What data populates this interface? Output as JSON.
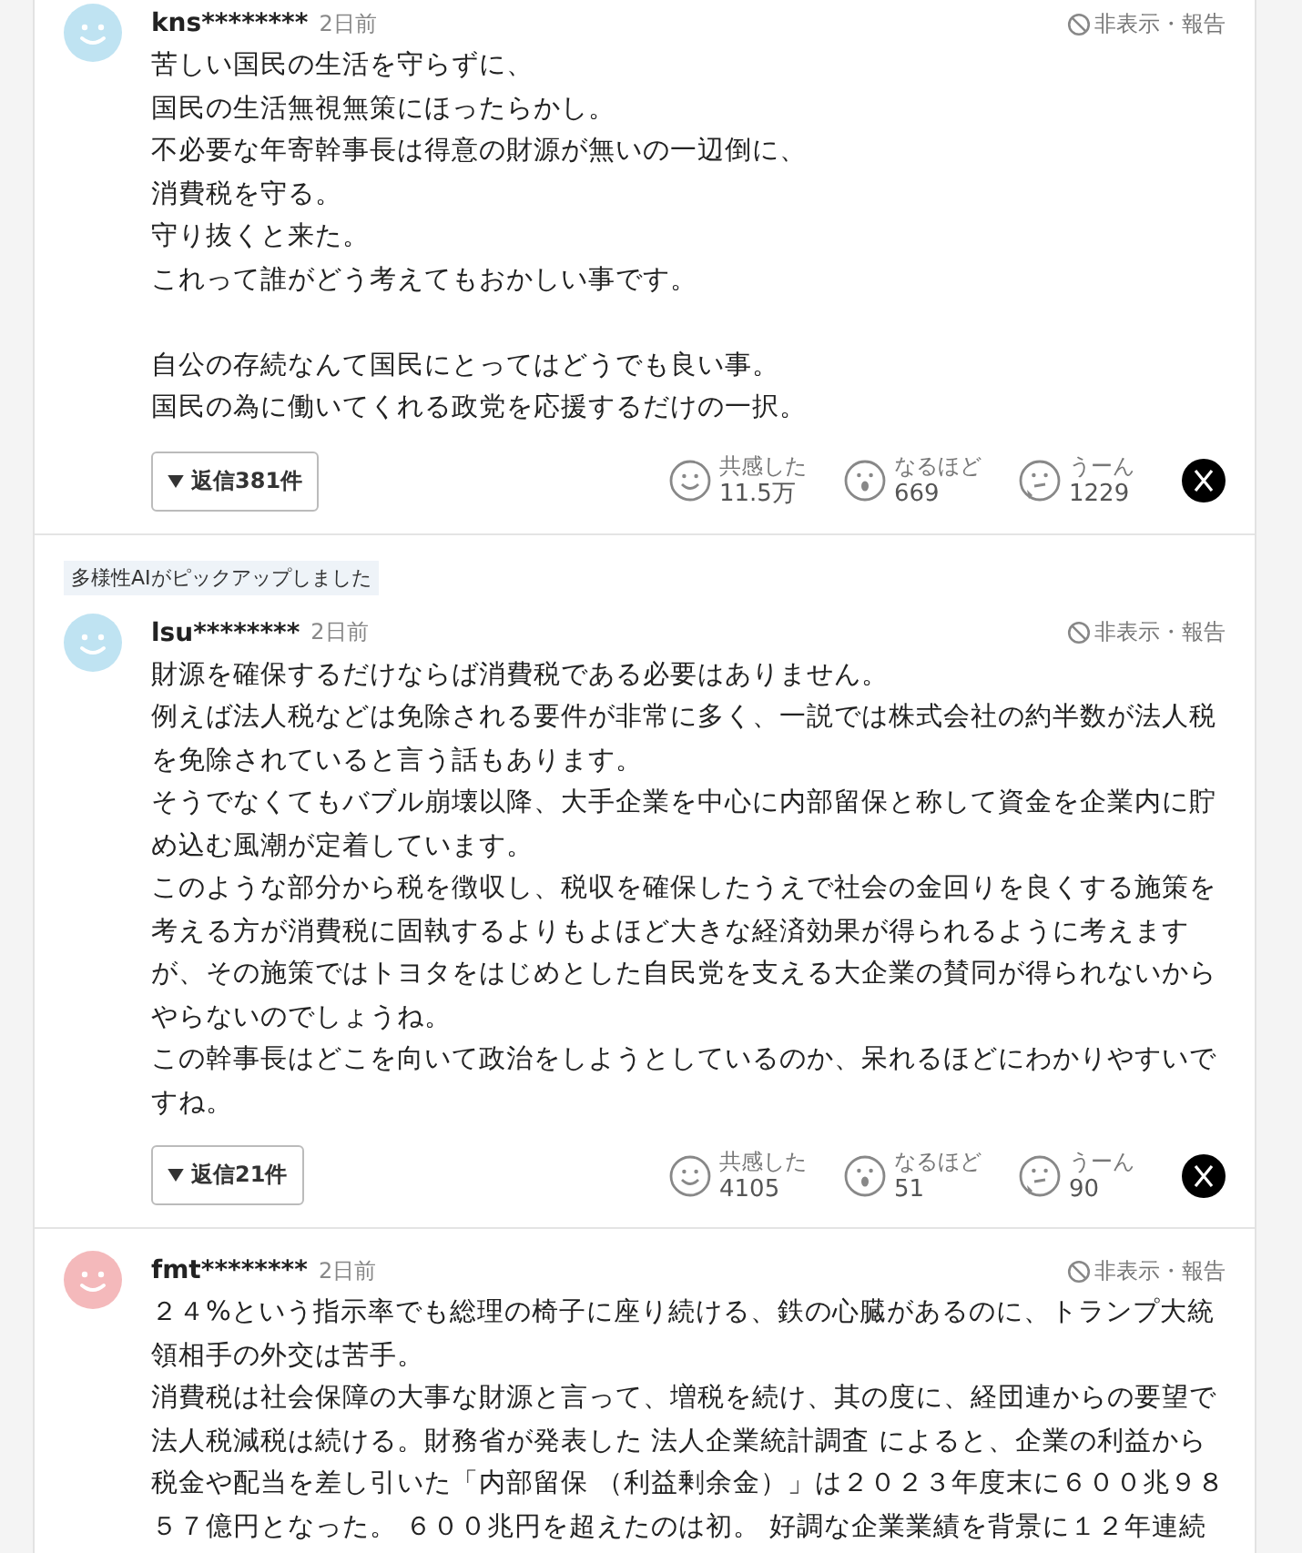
{
  "comments": [
    {
      "user": "kns********",
      "time": "2日前",
      "color": "#bfe3f2",
      "hide_label": "非表示・報告",
      "paragraphs": [
        [
          "苦しい国民の生活を守らずに、",
          "国民の生活無視無策にほったらかし。",
          "不必要な年寄幹事長は得意の財源が無いの一辺倒に、",
          "消費税を守る。",
          "守り抜くと来た。",
          "これって誰がどう考えてもおかしい事です。"
        ],
        [
          "自公の存続なんて国民にとってはどうでも良い事。",
          "国民の為に働いてくれる政党を応援するだけの一択。"
        ]
      ],
      "replies": "返信381件",
      "reactions": [
        {
          "kind": "empathy",
          "label": "共感した",
          "count": "11.5万"
        },
        {
          "kind": "insight",
          "label": "なるほど",
          "count": "669"
        },
        {
          "kind": "doubt",
          "label": "うーん",
          "count": "1229"
        }
      ]
    },
    {
      "badge": "多様性AIがピックアップしました",
      "user": "lsu********",
      "time": "2日前",
      "color": "#bfe3f2",
      "hide_label": "非表示・報告",
      "paragraphs": [
        [
          "財源を確保するだけならば消費税である必要はありません。",
          "例えば法人税などは免除される要件が非常に多く、一説では株式会社の約半数が法人税を免除されていると言う話もあります。",
          "そうでなくてもバブル崩壊以降、大手企業を中心に内部留保と称して資金を企業内に貯め込む風潮が定着しています。",
          "このような部分から税を徴収し、税収を確保したうえで社会の金回りを良くする施策を考える方が消費税に固執するよりもよほど大きな経済効果が得られるように考えますが、その施策ではトヨタをはじめとした自民党を支える大企業の賛同が得られないからやらないのでしょうね。",
          "この幹事長はどこを向いて政治をしようとしているのか、呆れるほどにわかりやすいですね。"
        ]
      ],
      "replies": "返信21件",
      "reactions": [
        {
          "kind": "empathy",
          "label": "共感した",
          "count": "4105"
        },
        {
          "kind": "insight",
          "label": "なるほど",
          "count": "51"
        },
        {
          "kind": "doubt",
          "label": "うーん",
          "count": "90"
        }
      ]
    },
    {
      "user": "fmt********",
      "time": "2日前",
      "color": "#f4b9bb",
      "hide_label": "非表示・報告",
      "paragraphs": [
        [
          "２４%という指示率でも総理の椅子に座り続ける、鉄の心臓があるのに、トランプ大統領相手の外交は苦手。",
          "消費税は社会保障の大事な財源と言って、増税を続け、其の度に、経団連からの要望で法人税減税は続ける。財務省が発表した 法人企業統計調査 によると、企業の利益から税金や配当を差し引いた「内部留保 （利益剰余金）」は２０２３年度末に６００兆９８５７億円となった。 ６００兆円を超えたのは初。 好調な企業業績を背景に１２年連続"
        ]
      ]
    }
  ]
}
